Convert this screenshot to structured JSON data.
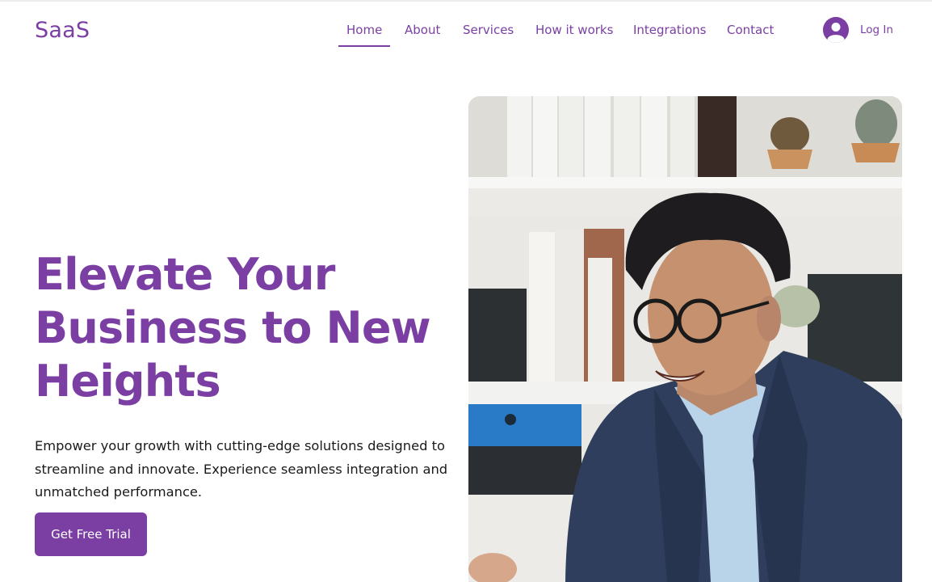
{
  "header": {
    "logo": "SaaS",
    "nav": [
      {
        "label": "Home",
        "active": true
      },
      {
        "label": "About"
      },
      {
        "label": "Services"
      },
      {
        "label": "How it works"
      },
      {
        "label": "Integrations"
      },
      {
        "label": "Contact"
      }
    ],
    "login_label": "Log In",
    "login_icon": "user-avatar-icon"
  },
  "hero": {
    "headline_lines": [
      "Elevate Your",
      "Business to New",
      "Heights"
    ],
    "subtext_lines": [
      "Empower your growth with cutting-edge solutions designed to",
      "streamline and innovate. Experience seamless integration and",
      "unmatched performance."
    ],
    "cta_label": "Get Free Trial",
    "image": "smiling-businessman-photo"
  },
  "colors": {
    "brand": "#7b3fa3",
    "text": "#1a1a1a",
    "background": "#ffffff"
  }
}
